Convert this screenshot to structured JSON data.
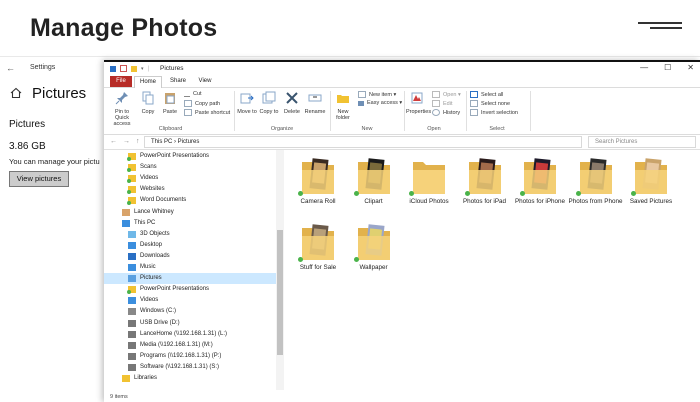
{
  "page": {
    "title": "Manage Photos"
  },
  "settings": {
    "window_title": "Settings",
    "header": "Pictures",
    "section": "Pictures",
    "size": "3.86 GB",
    "description": "You can manage your pictu",
    "view_button": "View pictures"
  },
  "explorer": {
    "title": "Pictures",
    "controls": {
      "minimize": "—",
      "maximize": "☐",
      "close": "✕"
    },
    "tabs": {
      "file": "File",
      "home": "Home",
      "share": "Share",
      "view": "View"
    },
    "ribbon": {
      "pin": "Pin to Quick access",
      "copy": "Copy",
      "paste": "Paste",
      "cut": "Cut",
      "copy_path": "Copy path",
      "paste_shortcut": "Paste shortcut",
      "move_to": "Move to",
      "copy_to": "Copy to",
      "delete": "Delete",
      "rename": "Rename",
      "new_folder": "New folder",
      "new_item": "New item ▾",
      "easy_access": "Easy access ▾",
      "properties": "Properties",
      "open": "Open ▾",
      "edit": "Edit",
      "history": "History",
      "select_all": "Select all",
      "select_none": "Select none",
      "invert_selection": "Invert selection",
      "groups": {
        "clipboard": "Clipboard",
        "organize": "Organize",
        "new": "New",
        "open": "Open",
        "select": "Select"
      }
    },
    "address": {
      "path": "This PC  ›  Pictures",
      "search_placeholder": "Search Pictures"
    },
    "nav_items": [
      {
        "label": "PowerPoint Presentations",
        "icon": "folder-icon"
      },
      {
        "label": "Scans",
        "icon": "folder-icon"
      },
      {
        "label": "Videos",
        "icon": "folder-icon"
      },
      {
        "label": "Websites",
        "icon": "folder-icon"
      },
      {
        "label": "Word Documents",
        "icon": "folder-icon"
      },
      {
        "label": "Lance Whitney",
        "icon": "user-icon"
      },
      {
        "label": "This PC",
        "icon": "pc-icon"
      },
      {
        "label": "3D Objects",
        "icon": "cube-icon"
      },
      {
        "label": "Desktop",
        "icon": "desktop-icon"
      },
      {
        "label": "Downloads",
        "icon": "download-icon"
      },
      {
        "label": "Music",
        "icon": "music-icon"
      },
      {
        "label": "Pictures",
        "icon": "pictures-icon",
        "selected": true
      },
      {
        "label": "PowerPoint Presentations",
        "icon": "folder-icon"
      },
      {
        "label": "Videos",
        "icon": "videos-icon"
      },
      {
        "label": "Windows (C:)",
        "icon": "drive-icon"
      },
      {
        "label": "USB Drive (D:)",
        "icon": "usb-drive-icon"
      },
      {
        "label": "LanceHome (\\\\192.168.1.31) (L:)",
        "icon": "network-drive-icon"
      },
      {
        "label": "Media (\\\\192.168.1.31) (M:)",
        "icon": "network-drive-icon"
      },
      {
        "label": "Programs (\\\\192.168.1.31) (P:)",
        "icon": "network-drive-icon"
      },
      {
        "label": "Software (\\\\192.168.1.31) (S:)",
        "icon": "network-drive-icon"
      },
      {
        "label": "Libraries",
        "icon": "libraries-icon"
      }
    ],
    "folders": [
      {
        "label": "Camera Roll"
      },
      {
        "label": "Clipart"
      },
      {
        "label": "iCloud Photos"
      },
      {
        "label": "Photos for iPad"
      },
      {
        "label": "Photos for iPhone"
      },
      {
        "label": "Photos from Phone"
      },
      {
        "label": "Saved Pictures"
      },
      {
        "label": "Stuff for Sale"
      },
      {
        "label": "Wallpaper"
      }
    ],
    "status": "9 items"
  }
}
